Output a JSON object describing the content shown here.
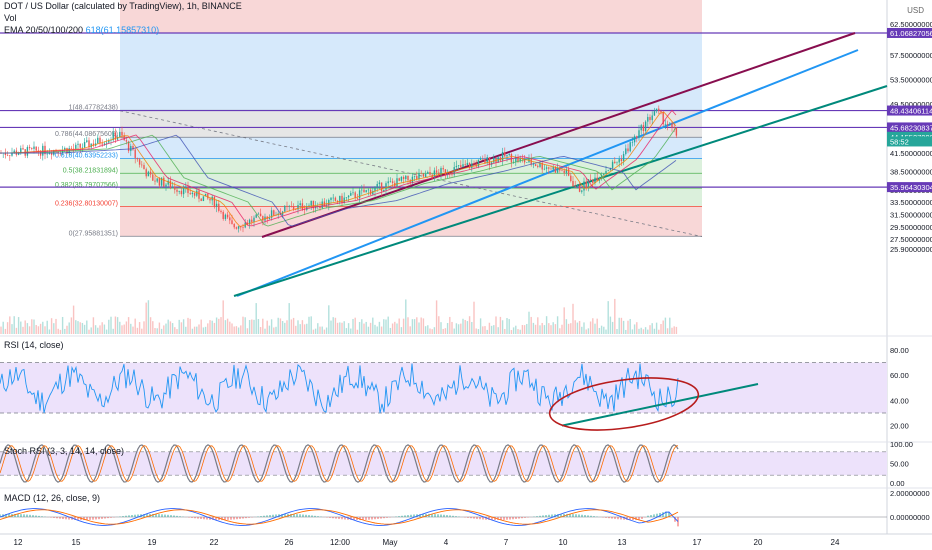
{
  "header": {
    "title": "DOT / US Dollar (calculated by TradingView), 1h, BINANCE",
    "vol_label": "Vol",
    "ema_label": "EMA 20/50/100/200",
    "fib_note": "618(61.15857310)"
  },
  "price_axis": {
    "unit": "USD",
    "ticks": [
      "67.50000000",
      "62.50000000",
      "57.50000000",
      "53.50000000",
      "49.50000000",
      "45.50000000",
      "41.50000000",
      "38.50000000",
      "35.50000000",
      "33.50000000",
      "31.50000000",
      "29.50000000",
      "27.50000000",
      "25.90000000"
    ],
    "tick_values": [
      67.5,
      62.5,
      57.5,
      53.5,
      49.5,
      45.5,
      41.5,
      38.5,
      35.5,
      33.5,
      31.5,
      29.5,
      27.5,
      25.9
    ],
    "badges": [
      {
        "text": "61.06827056",
        "value": 61.06827056,
        "color": "#673ab7"
      },
      {
        "text": "48.43406114",
        "value": 48.43406114,
        "color": "#673ab7"
      },
      {
        "text": "45.68230837",
        "value": 45.68230837,
        "color": "#673ab7"
      },
      {
        "text": "44.15527098",
        "value": 44.15527098,
        "color": "#26a69a"
      },
      {
        "text": "58:52",
        "value": 43.4,
        "color": "#26a69a"
      },
      {
        "text": "35.96430304",
        "value": 35.96430304,
        "color": "#673ab7"
      }
    ]
  },
  "fib_levels": [
    {
      "label": "1(48.47782438)",
      "value": 48.47782438
    },
    {
      "label": "0.786(44.08675605)",
      "value": 44.08675605
    },
    {
      "label": "0.618(40.63952233)",
      "value": 40.63952233
    },
    {
      "label": "0.5(38.21831894)",
      "value": 38.21831894
    },
    {
      "label": "0.382(35.79707566)",
      "value": 35.79707566
    },
    {
      "label": "0.236(32.80130007)",
      "value": 32.80130007
    },
    {
      "label": "0(27.95881351)",
      "value": 27.95881351
    }
  ],
  "time_axis": {
    "labels": [
      "12",
      "15",
      "19",
      "22",
      "26",
      "12:00",
      "May",
      "4",
      "7",
      "10",
      "13",
      "17",
      "20",
      "24"
    ]
  },
  "rsi": {
    "title": "RSI (14, close)",
    "ticks": [
      "80.00",
      "60.00",
      "40.00",
      "20.00"
    ],
    "tick_values": [
      80,
      60,
      40,
      20
    ]
  },
  "stoch": {
    "title": "Stoch RSI (3, 3, 14, 14, close)",
    "ticks": [
      "100.00",
      "50.00",
      "0.00"
    ],
    "tick_values": [
      100,
      50,
      0
    ]
  },
  "macd": {
    "title": "MACD (12, 26, close, 9)",
    "ticks": [
      "2.00000000",
      "0.00000000"
    ],
    "tick_values": [
      2,
      0
    ]
  },
  "colors": {
    "fib_zone_top": "#f8d7d7",
    "fib_zone_blue": "#d6e9fb",
    "fib_zone_grey": "#e6e6e6",
    "fib_zone_green": "#dbf0dc",
    "channel_upper": "#880e4f",
    "channel_mid": "#2196f3",
    "channel_lower": "#00897b",
    "hline": "#673ab7",
    "rsi_band": "#ede2fb",
    "rsi_line": "#2196f3",
    "ellipse": "#b71c1c"
  },
  "chart_data": {
    "type": "candlestick",
    "description_series": [
      {
        "name": "EMA 20/50/100/200"
      }
    ],
    "horizontal_levels": [
      61.06827056,
      48.43406114,
      45.68230837,
      35.96430304
    ],
    "last_price": 44.15527098,
    "approx_close_path": [
      {
        "x": "12",
        "y": 41.5
      },
      {
        "x": "15",
        "y": 42.2
      },
      {
        "x": "17",
        "y": 44.5
      },
      {
        "x": "19",
        "y": 37.5
      },
      {
        "x": "22",
        "y": 33.5
      },
      {
        "x": "23",
        "y": 29.5
      },
      {
        "x": "26",
        "y": 32.5
      },
      {
        "x": "12:00",
        "y": 33.8
      },
      {
        "x": "May",
        "y": 36.5
      },
      {
        "x": "4",
        "y": 38.5
      },
      {
        "x": "7",
        "y": 41.0
      },
      {
        "x": "10",
        "y": 38.5
      },
      {
        "x": "11",
        "y": 35.5
      },
      {
        "x": "13",
        "y": 40.5
      },
      {
        "x": "14",
        "y": 48.5
      },
      {
        "x": "15",
        "y": 44.2
      }
    ],
    "ylim": [
      24.5,
      69.0
    ]
  }
}
